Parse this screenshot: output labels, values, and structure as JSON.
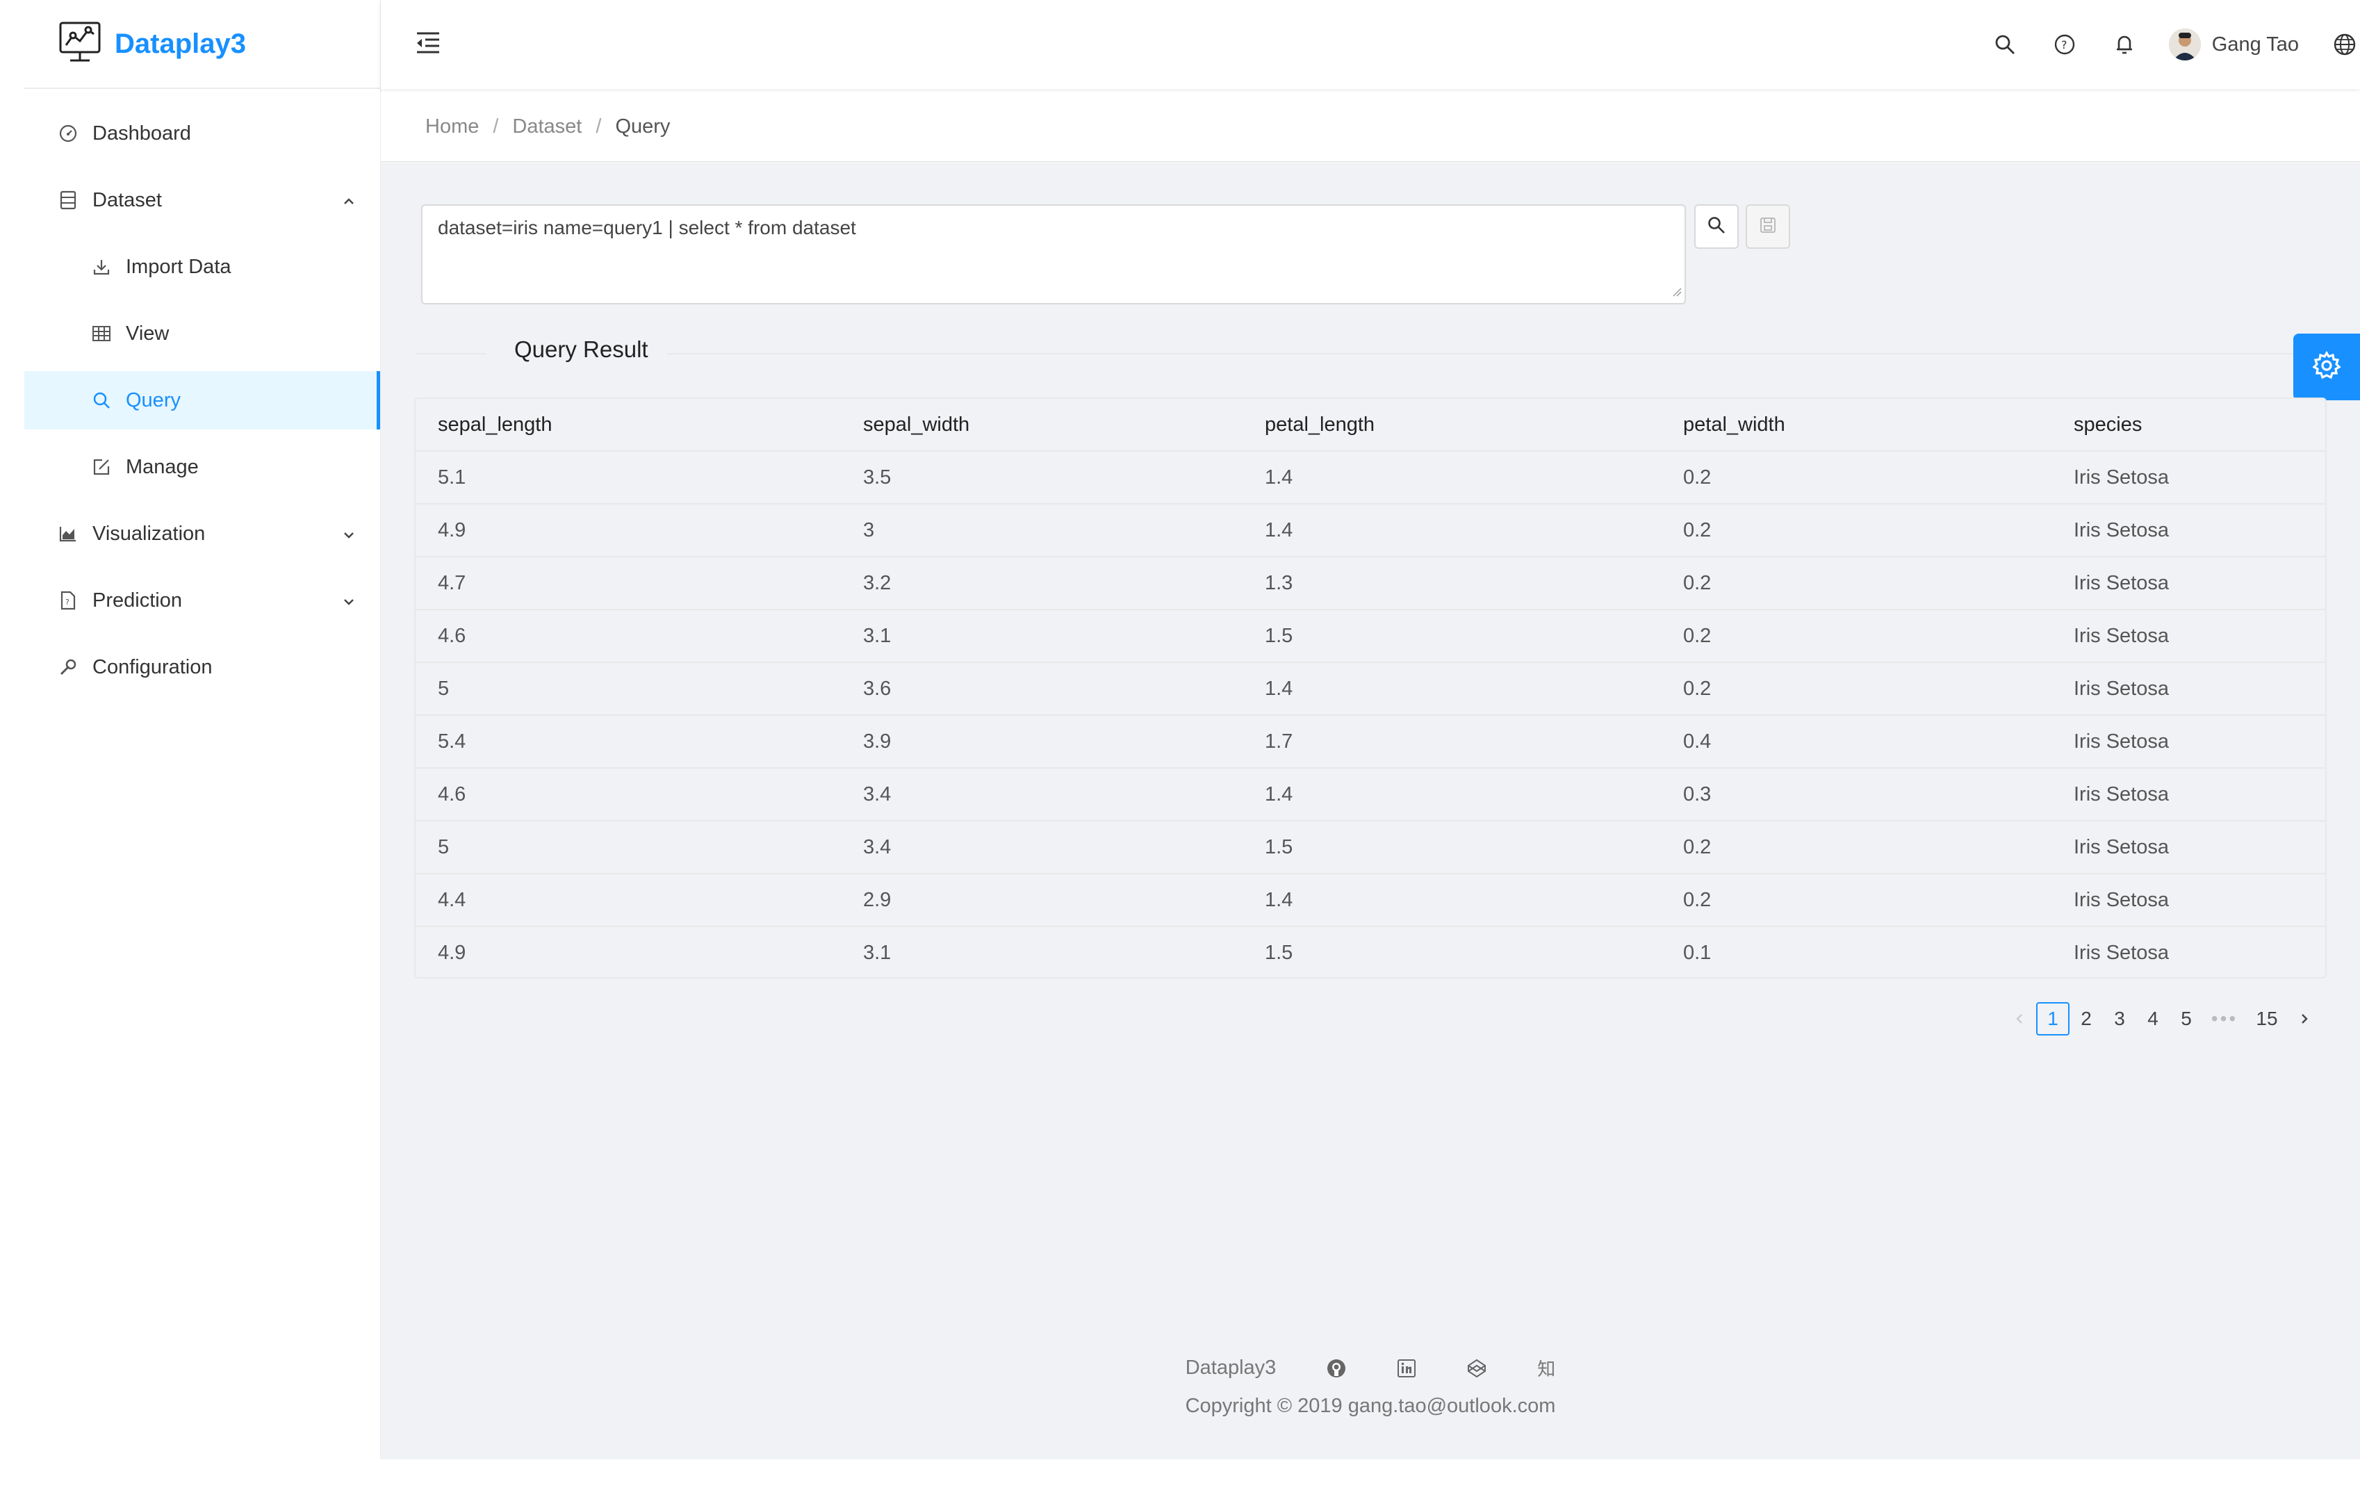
{
  "app": {
    "name": "Dataplay3"
  },
  "sidebar": {
    "items": [
      {
        "label": "Dashboard",
        "icon": "dashboard-icon"
      },
      {
        "label": "Dataset",
        "icon": "database-icon",
        "expanded": true
      },
      {
        "label": "Import Data",
        "icon": "download-icon"
      },
      {
        "label": "View",
        "icon": "table-icon"
      },
      {
        "label": "Query",
        "icon": "search-icon",
        "active": true
      },
      {
        "label": "Manage",
        "icon": "edit-icon"
      },
      {
        "label": "Visualization",
        "icon": "area-chart-icon",
        "expanded": false
      },
      {
        "label": "Prediction",
        "icon": "file-icon",
        "expanded": false
      },
      {
        "label": "Configuration",
        "icon": "tool-icon"
      }
    ]
  },
  "header": {
    "user_name": "Gang Tao"
  },
  "breadcrumb": {
    "items": [
      "Home",
      "Dataset",
      "Query"
    ]
  },
  "query": {
    "text": "dataset=iris name=query1 | select * from dataset"
  },
  "result": {
    "title": "Query Result",
    "columns": [
      "sepal_length",
      "sepal_width",
      "petal_length",
      "petal_width",
      "species"
    ],
    "rows": [
      [
        "5.1",
        "3.5",
        "1.4",
        "0.2",
        "Iris Setosa"
      ],
      [
        "4.9",
        "3",
        "1.4",
        "0.2",
        "Iris Setosa"
      ],
      [
        "4.7",
        "3.2",
        "1.3",
        "0.2",
        "Iris Setosa"
      ],
      [
        "4.6",
        "3.1",
        "1.5",
        "0.2",
        "Iris Setosa"
      ],
      [
        "5",
        "3.6",
        "1.4",
        "0.2",
        "Iris Setosa"
      ],
      [
        "5.4",
        "3.9",
        "1.7",
        "0.4",
        "Iris Setosa"
      ],
      [
        "4.6",
        "3.4",
        "1.4",
        "0.3",
        "Iris Setosa"
      ],
      [
        "5",
        "3.4",
        "1.5",
        "0.2",
        "Iris Setosa"
      ],
      [
        "4.4",
        "2.9",
        "1.4",
        "0.2",
        "Iris Setosa"
      ],
      [
        "4.9",
        "3.1",
        "1.5",
        "0.1",
        "Iris Setosa"
      ]
    ]
  },
  "pagination": {
    "pages": [
      "1",
      "2",
      "3",
      "4",
      "5",
      "•••",
      "15"
    ],
    "current": "1"
  },
  "footer": {
    "brand": "Dataplay3",
    "zhihu_glyph": "知",
    "copyright": "Copyright © 2019 gang.tao@outlook.com"
  },
  "colors": {
    "accent": "#1890ff",
    "background": "#f0f2f5"
  }
}
